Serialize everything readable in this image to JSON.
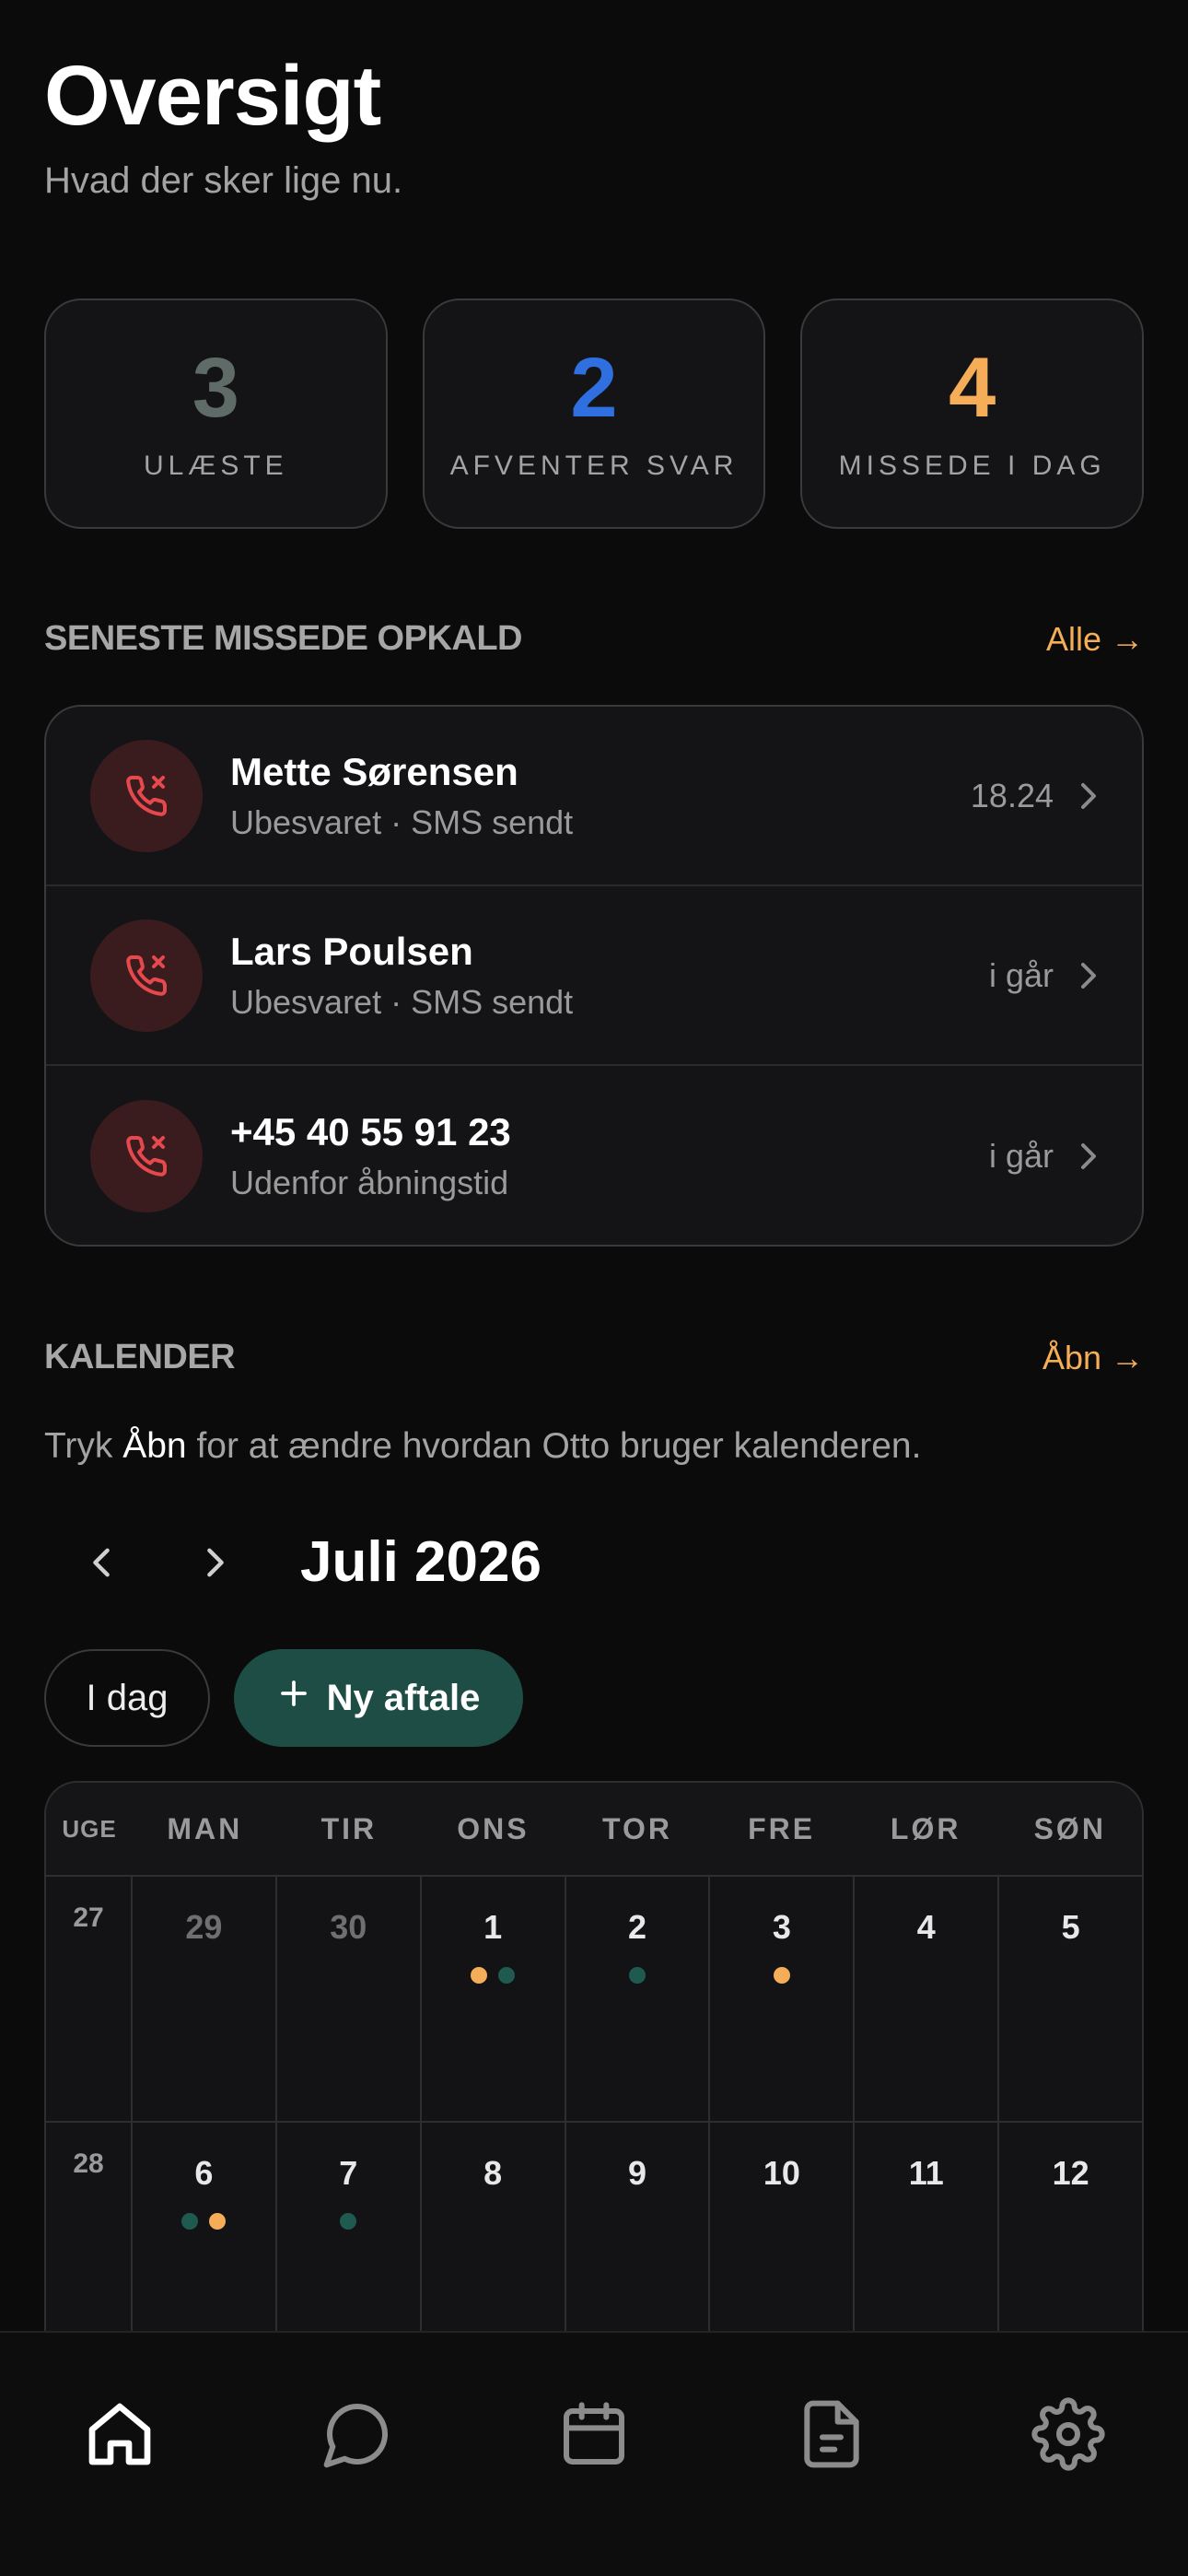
{
  "header": {
    "title": "Oversigt",
    "subtitle": "Hvad der sker lige nu."
  },
  "stats": [
    {
      "value": "3",
      "label": "ULÆSTE",
      "color": "#5f6b66"
    },
    {
      "value": "2",
      "label": "AFVENTER SVAR",
      "color": "#2f6fe0"
    },
    {
      "value": "4",
      "label": "MISSEDE I DAG",
      "color": "#f5ad58"
    }
  ],
  "missed": {
    "title": "SENESTE MISSEDE OPKALD",
    "link": "Alle →",
    "calls": [
      {
        "name": "Mette Sørensen",
        "sub": "Ubesvaret · SMS sendt",
        "time": "18.24",
        "icon": "missed-call-icon"
      },
      {
        "name": "Lars Poulsen",
        "sub": "Ubesvaret · SMS sendt",
        "time": "i går",
        "icon": "missed-call-icon"
      },
      {
        "name": "+45 40 55 91 23",
        "sub": "Udenfor åbningstid",
        "time": "i går",
        "icon": "missed-call-icon"
      }
    ]
  },
  "calendar": {
    "title": "KALENDER",
    "link": "Åbn →",
    "note_prefix": "Tryk ",
    "note_bold": "Åbn",
    "note_suffix": " for at ændre hvordan Otto bruger kalenderen.",
    "month": "Juli 2026",
    "today_button": "I dag",
    "new_button": "Ny aftale",
    "week_header": "UGE",
    "days": [
      "MAN",
      "TIR",
      "ONS",
      "TOR",
      "FRE",
      "LØR",
      "SØN"
    ],
    "weeks": [
      {
        "week": "27",
        "cells": [
          {
            "d": "29",
            "muted": true,
            "dots": []
          },
          {
            "d": "30",
            "muted": true,
            "dots": []
          },
          {
            "d": "1",
            "muted": false,
            "dots": [
              "orange",
              "green"
            ]
          },
          {
            "d": "2",
            "muted": false,
            "dots": [
              "green"
            ]
          },
          {
            "d": "3",
            "muted": false,
            "dots": [
              "orange"
            ]
          },
          {
            "d": "4",
            "muted": false,
            "dots": []
          },
          {
            "d": "5",
            "muted": false,
            "dots": []
          }
        ]
      },
      {
        "week": "28",
        "cells": [
          {
            "d": "6",
            "muted": false,
            "dots": [
              "green",
              "orange"
            ]
          },
          {
            "d": "7",
            "muted": false,
            "dots": [
              "green"
            ]
          },
          {
            "d": "8",
            "muted": false,
            "dots": []
          },
          {
            "d": "9",
            "muted": false,
            "dots": []
          },
          {
            "d": "10",
            "muted": false,
            "dots": []
          },
          {
            "d": "11",
            "muted": false,
            "dots": []
          },
          {
            "d": "12",
            "muted": false,
            "dots": []
          }
        ]
      }
    ]
  },
  "colors": {
    "accent": "#f5ad58",
    "event_green": "#1e5a4f",
    "primary_button": "#1e4d45",
    "missed_icon": "#e5484d"
  },
  "tabbar": [
    "home-icon",
    "chat-icon",
    "calendar-icon",
    "document-icon",
    "settings-icon"
  ]
}
